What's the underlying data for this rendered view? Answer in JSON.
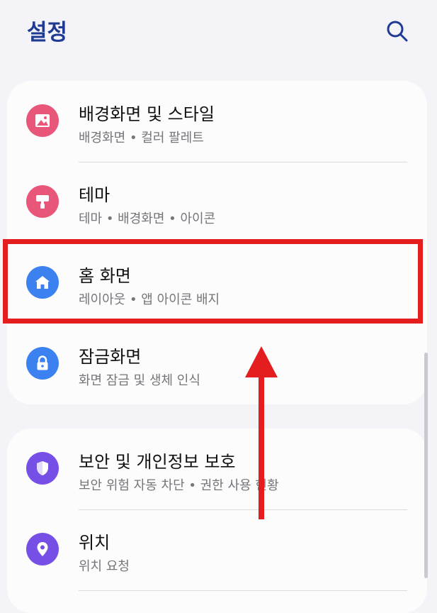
{
  "header": {
    "title": "설정",
    "search_icon": "search-icon"
  },
  "colors": {
    "accent": "#1f3a93",
    "wallpaper_icon_bg": "#e8567a",
    "theme_icon_bg": "#e8567a",
    "home_icon_bg": "#3b82f0",
    "lock_icon_bg": "#3b82f0",
    "security_icon_bg": "#7650e6",
    "location_icon_bg": "#7650e6",
    "annotation": "#e41e1e"
  },
  "settings_groups": [
    {
      "items": [
        {
          "title": "배경화면 및 스타일",
          "subtitle": "배경화면  •  컬러 팔레트",
          "icon": "image-icon"
        },
        {
          "title": "테마",
          "subtitle": "테마  •  배경화면  •  아이콘",
          "icon": "paint-brush-icon"
        },
        {
          "title": "홈 화면",
          "subtitle": "레이아웃  •  앱 아이콘 배지",
          "icon": "home-icon"
        },
        {
          "title": "잠금화면",
          "subtitle": "화면 잠금 및 생체 인식",
          "icon": "lock-icon"
        }
      ]
    },
    {
      "items": [
        {
          "title": "보안 및 개인정보 보호",
          "subtitle": "보안 위험 자동 차단  •  권한 사용 현황",
          "icon": "shield-icon"
        },
        {
          "title": "위치",
          "subtitle": "위치 요청",
          "icon": "location-pin-icon"
        }
      ]
    }
  ]
}
